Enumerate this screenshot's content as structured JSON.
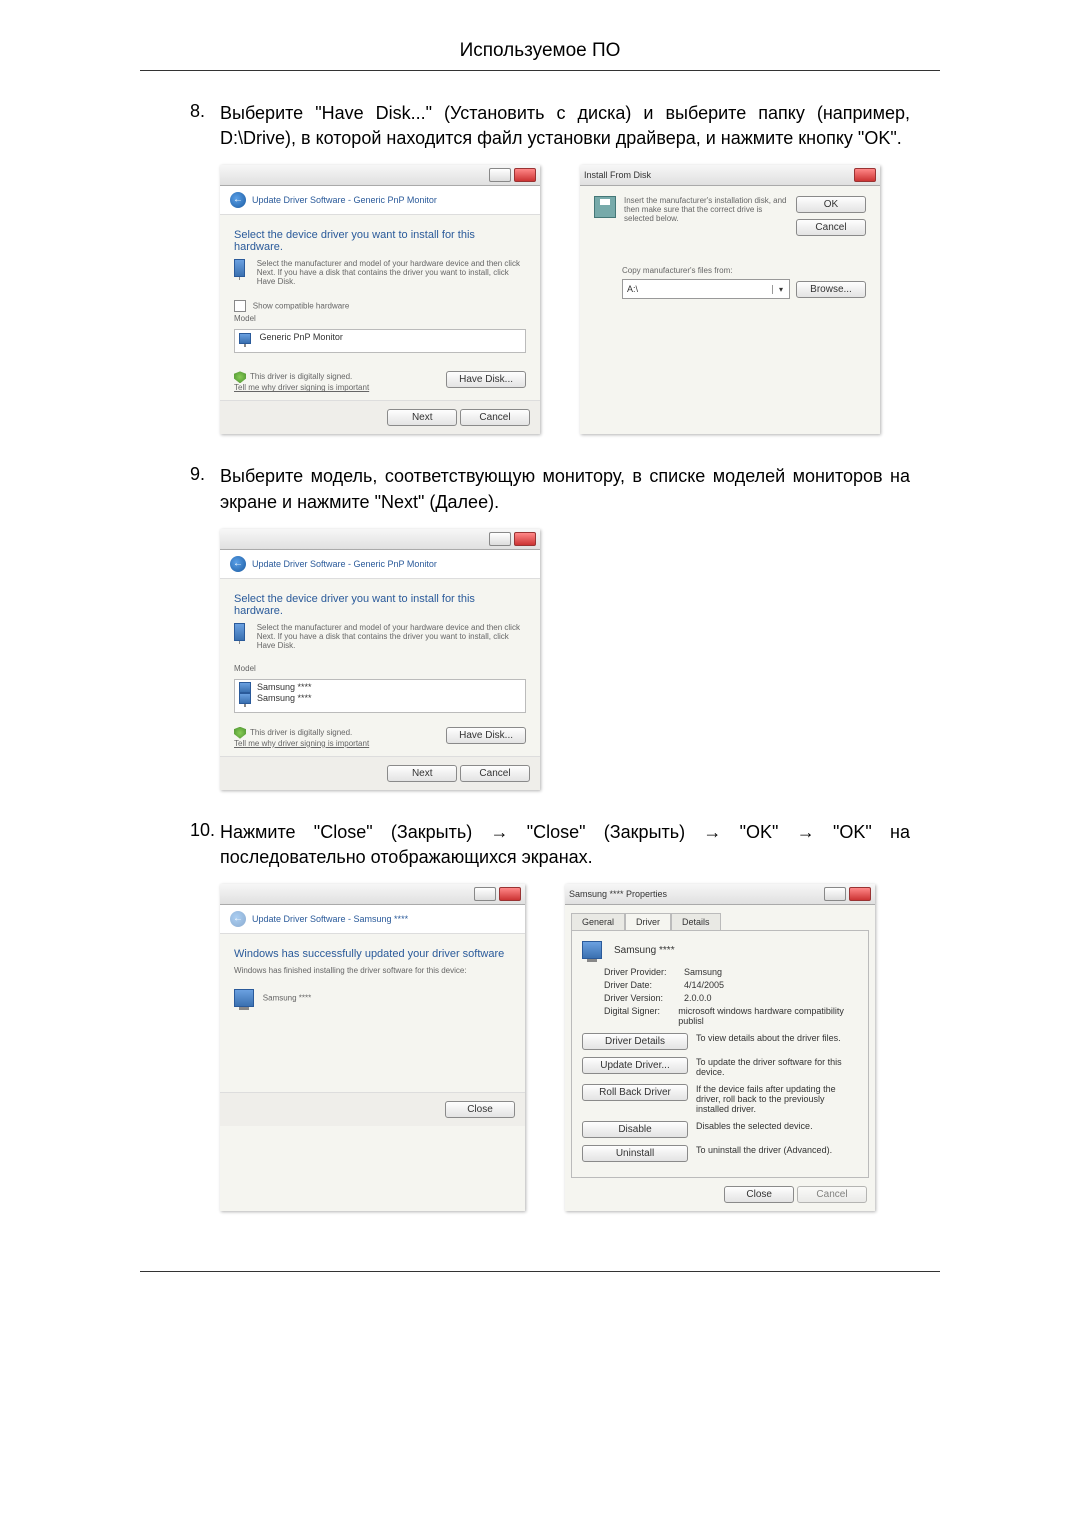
{
  "header": {
    "title": "Используемое ПО"
  },
  "steps": {
    "s8": {
      "num": "8.",
      "text": "Выберите \"Have Disk...\" (Установить с диска) и выберите папку (например, D:\\Drive), в которой находится файл установки драйвера, и нажмите кнопку \"OK\"."
    },
    "s9": {
      "num": "9.",
      "text": "Выберите модель, соответствующую монитору, в списке моделей мониторов на экране и нажмите \"Next\" (Далее)."
    },
    "s10": {
      "num": "10.",
      "text": "Нажмите \"Close\" (Закрыть) → \"Close\" (Закрыть) → \"OK\" → \"OK\" на последовательно отображающихся экранах."
    }
  },
  "dlg_driver": {
    "crumb": "Update Driver Software - Generic PnP Monitor",
    "heading": "Select the device driver you want to install for this hardware.",
    "hint": "Select the manufacturer and model of your hardware device and then click Next. If you have a disk that contains the driver you want to install, click Have Disk.",
    "show_compatible": "Show compatible hardware",
    "model_label": "Model",
    "model_item": "Generic PnP Monitor",
    "signed": "This driver is digitally signed.",
    "signing_link": "Tell me why driver signing is important",
    "btn_have_disk": "Have Disk...",
    "btn_next": "Next",
    "btn_cancel": "Cancel"
  },
  "dlg_install_disk": {
    "title": "Install From Disk",
    "msg": "Insert the manufacturer's installation disk, and then make sure that the correct drive is selected below.",
    "btn_ok": "OK",
    "btn_cancel": "Cancel",
    "copy_label": "Copy manufacturer's files from:",
    "path": "A:\\",
    "btn_browse": "Browse..."
  },
  "dlg_driver2": {
    "crumb": "Update Driver Software - Generic PnP Monitor",
    "heading": "Select the device driver you want to install for this hardware.",
    "hint": "Select the manufacturer and model of your hardware device and then click Next. If you have a disk that contains the driver you want to install, click Have Disk.",
    "model_label": "Model",
    "model_item1": "Samsung ****",
    "model_item2": "Samsung ****",
    "signed": "This driver is digitally signed.",
    "signing_link": "Tell me why driver signing is important",
    "btn_have_disk": "Have Disk...",
    "btn_next": "Next",
    "btn_cancel": "Cancel"
  },
  "dlg_done": {
    "crumb": "Update Driver Software - Samsung ****",
    "heading": "Windows has successfully updated your driver software",
    "sub": "Windows has finished installing the driver software for this device:",
    "device": "Samsung ****",
    "btn_close": "Close"
  },
  "dlg_props": {
    "title": "Samsung **** Properties",
    "tab_general": "General",
    "tab_driver": "Driver",
    "tab_details": "Details",
    "device": "Samsung ****",
    "provider_k": "Driver Provider:",
    "provider_v": "Samsung",
    "date_k": "Driver Date:",
    "date_v": "4/14/2005",
    "version_k": "Driver Version:",
    "version_v": "2.0.0.0",
    "signer_k": "Digital Signer:",
    "signer_v": "microsoft windows hardware compatibility publisl",
    "btn_details": "Driver Details",
    "desc_details": "To view details about the driver files.",
    "btn_update": "Update Driver...",
    "desc_update": "To update the driver software for this device.",
    "btn_rollback": "Roll Back Driver",
    "desc_rollback": "If the device fails after updating the driver, roll back to the previously installed driver.",
    "btn_disable": "Disable",
    "desc_disable": "Disables the selected device.",
    "btn_uninstall": "Uninstall",
    "desc_uninstall": "To uninstall the driver (Advanced).",
    "btn_close": "Close",
    "btn_cancel": "Cancel"
  }
}
